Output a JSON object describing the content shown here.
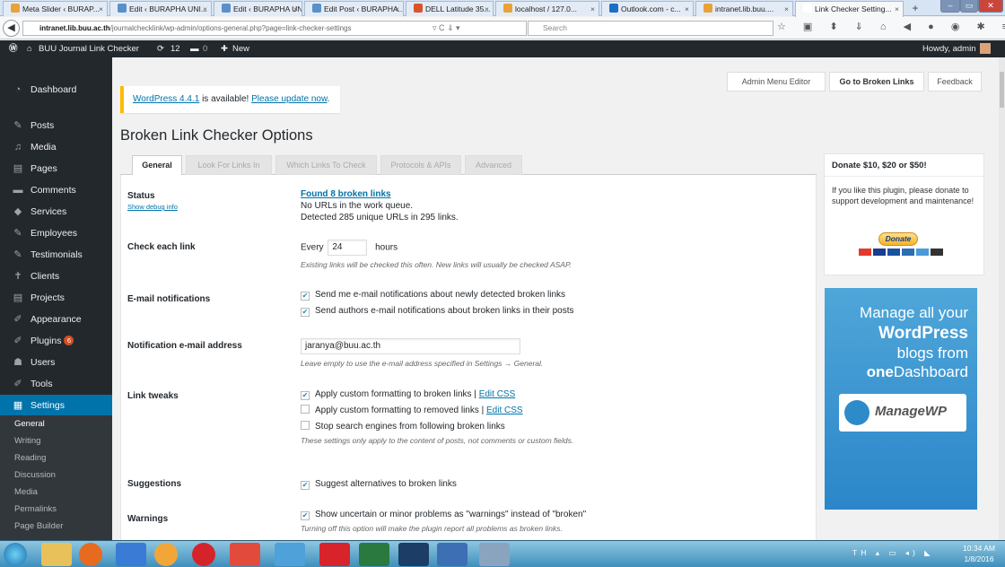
{
  "browser": {
    "tabs": [
      {
        "title": "Meta Slider ‹ BURAP...",
        "color": "#e9a23b"
      },
      {
        "title": "Edit ‹ BURAPHA UNI...",
        "color": "#5b8fc9"
      },
      {
        "title": "Edit ‹ BURAPHA UNI...",
        "color": "#5b8fc9"
      },
      {
        "title": "Edit Post ‹ BURAPHA...",
        "color": "#5b8fc9"
      },
      {
        "title": "DELL Latitude 35...",
        "color": "#d9542b"
      },
      {
        "title": "localhost / 127.0...",
        "color": "#e9a23b"
      },
      {
        "title": "Outlook.com - c...",
        "color": "#1c6fc4"
      },
      {
        "title": "intranet.lib.buu....",
        "color": "#e9a23b"
      },
      {
        "title": "Link Checker Setting...",
        "color": "#ffffff"
      }
    ],
    "url_domain": "intranet.lib.buu.ac.th",
    "url_path": "/journalchecklink/wp-admin/options-general.php?page=link-checker-settings",
    "search_placeholder": "Search"
  },
  "adminbar": {
    "site": "BUU Journal Link Checker",
    "updates": "12",
    "comments": "0",
    "new": "New",
    "howdy": "Howdy, admin"
  },
  "menu": [
    {
      "label": "Dashboard",
      "icon": "dashboard-icon",
      "glyph": "◔",
      "badge": ""
    },
    {
      "label": "Posts",
      "icon": "pin-icon",
      "glyph": "✎",
      "badge": ""
    },
    {
      "label": "Media",
      "icon": "media-icon",
      "glyph": "♫",
      "badge": ""
    },
    {
      "label": "Pages",
      "icon": "pages-icon",
      "glyph": "▤",
      "badge": ""
    },
    {
      "label": "Comments",
      "icon": "comment-icon",
      "glyph": "▬",
      "badge": ""
    },
    {
      "label": "Services",
      "icon": "services-icon",
      "glyph": "◆",
      "badge": ""
    },
    {
      "label": "Employees",
      "icon": "employees-icon",
      "glyph": "✎",
      "badge": ""
    },
    {
      "label": "Testimonials",
      "icon": "testimonials-icon",
      "glyph": "✎",
      "badge": ""
    },
    {
      "label": "Clients",
      "icon": "clients-icon",
      "glyph": "✝",
      "badge": ""
    },
    {
      "label": "Projects",
      "icon": "projects-icon",
      "glyph": "▤",
      "badge": ""
    },
    {
      "label": "Appearance",
      "icon": "appearance-icon",
      "glyph": "✐",
      "badge": ""
    },
    {
      "label": "Plugins",
      "icon": "plugins-icon",
      "glyph": "✐",
      "badge": "6"
    },
    {
      "label": "Users",
      "icon": "users-icon",
      "glyph": "☗",
      "badge": ""
    },
    {
      "label": "Tools",
      "icon": "tools-icon",
      "glyph": "✐",
      "badge": ""
    },
    {
      "label": "Settings",
      "icon": "settings-icon",
      "glyph": "▦",
      "badge": ""
    }
  ],
  "submenu": [
    "General",
    "Writing",
    "Reading",
    "Discussion",
    "Media",
    "Permalinks",
    "Page Builder"
  ],
  "topbuttons": {
    "menu_editor": "Admin Menu Editor",
    "broken": "Go to Broken Links",
    "feedback": "Feedback"
  },
  "notice": {
    "version": "WordPress 4.4.1",
    "text": "is available!",
    "link": "Please update now",
    "end": "."
  },
  "page_title": "Broken Link Checker Options",
  "tabs": [
    "General",
    "Look For Links In",
    "Which Links To Check",
    "Protocols & APIs",
    "Advanced"
  ],
  "settings": {
    "status": {
      "label": "Status",
      "debug": "Show debug info",
      "found": "Found 8 broken links",
      "queue": "No URLs in the work queue.",
      "detected": "Detected 285 unique URLs in 295 links."
    },
    "check": {
      "label": "Check each link",
      "every": "Every",
      "hours_value": "24",
      "hours": "hours",
      "desc": "Existing links will be checked this often. New links will usually be checked ASAP."
    },
    "email": {
      "label": "E-mail notifications",
      "opt1": "Send me e-mail notifications about newly detected broken links",
      "opt2": "Send authors e-mail notifications about broken links in their posts"
    },
    "address": {
      "label": "Notification e-mail address",
      "value": "jaranya@buu.ac.th",
      "desc": "Leave empty to use the e-mail address specified in Settings → General."
    },
    "tweaks": {
      "label": "Link tweaks",
      "opt1": "Apply custom formatting to broken links |",
      "opt1_link": "Edit CSS",
      "opt2": "Apply custom formatting to removed links |",
      "opt2_link": "Edit CSS",
      "opt3": "Stop search engines from following broken links",
      "desc": "These settings only apply to the content of posts, not comments or custom fields."
    },
    "suggest": {
      "label": "Suggestions",
      "opt1": "Suggest alternatives to broken links"
    },
    "warnings": {
      "label": "Warnings",
      "opt1": "Show uncertain or minor problems as \"warnings\" instead of \"broken\"",
      "desc": "Turning off this option will make the plugin report all problems as broken links."
    }
  },
  "donate": {
    "title": "Donate $10, $20 or $50!",
    "body": "If you like this plugin, please donate to support development and maintenance!",
    "button": "Donate"
  },
  "ad": {
    "l1": "Manage all your",
    "l2": "WordPress",
    "l3": "blogs from",
    "l4a": "one",
    "l4b": "Dashboard",
    "logo": "ManageWP"
  },
  "taskbar": {
    "lang": "TH",
    "time": "10:34 AM",
    "date": "1/8/2016"
  }
}
